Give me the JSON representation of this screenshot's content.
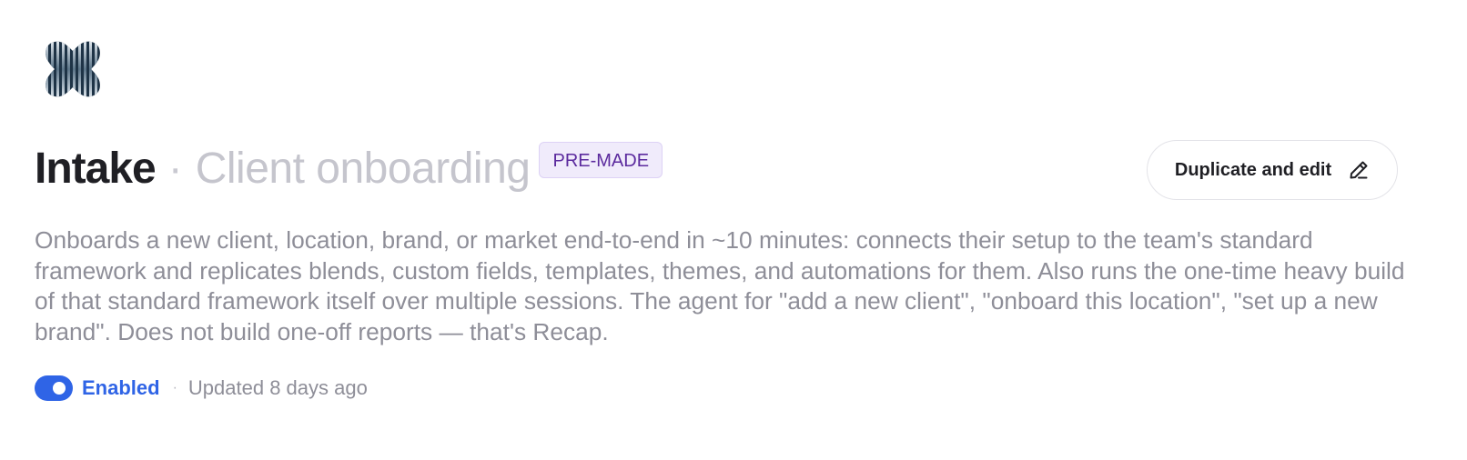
{
  "header": {
    "logo_icon": "striped-x-logo-icon",
    "title": "Intake",
    "separator": "·",
    "subtitle": "Client onboarding",
    "badge": "PRE-MADE"
  },
  "actions": {
    "duplicate_label": "Duplicate and edit",
    "duplicate_icon": "pencil-icon"
  },
  "description": "Onboards a new client, location, brand, or market end-to-end in ~10 minutes: connects their setup to the team's standard framework and replicates blends, custom fields, templates, themes, and automations for them. Also runs the one-time heavy build of that standard framework itself over multiple sessions. The agent for \"add a new client\", \"onboard this location\", \"set up a new brand\". Does not build one-off reports — that's Recap.",
  "status": {
    "enabled": true,
    "enabled_label": "Enabled",
    "separator": "·",
    "updated": "Updated 8 days ago"
  },
  "colors": {
    "accent": "#2f64e6",
    "badge_bg": "#f0ebfb",
    "badge_text": "#5b2a9e",
    "title": "#1f1f24",
    "muted": "#8e8e98"
  }
}
